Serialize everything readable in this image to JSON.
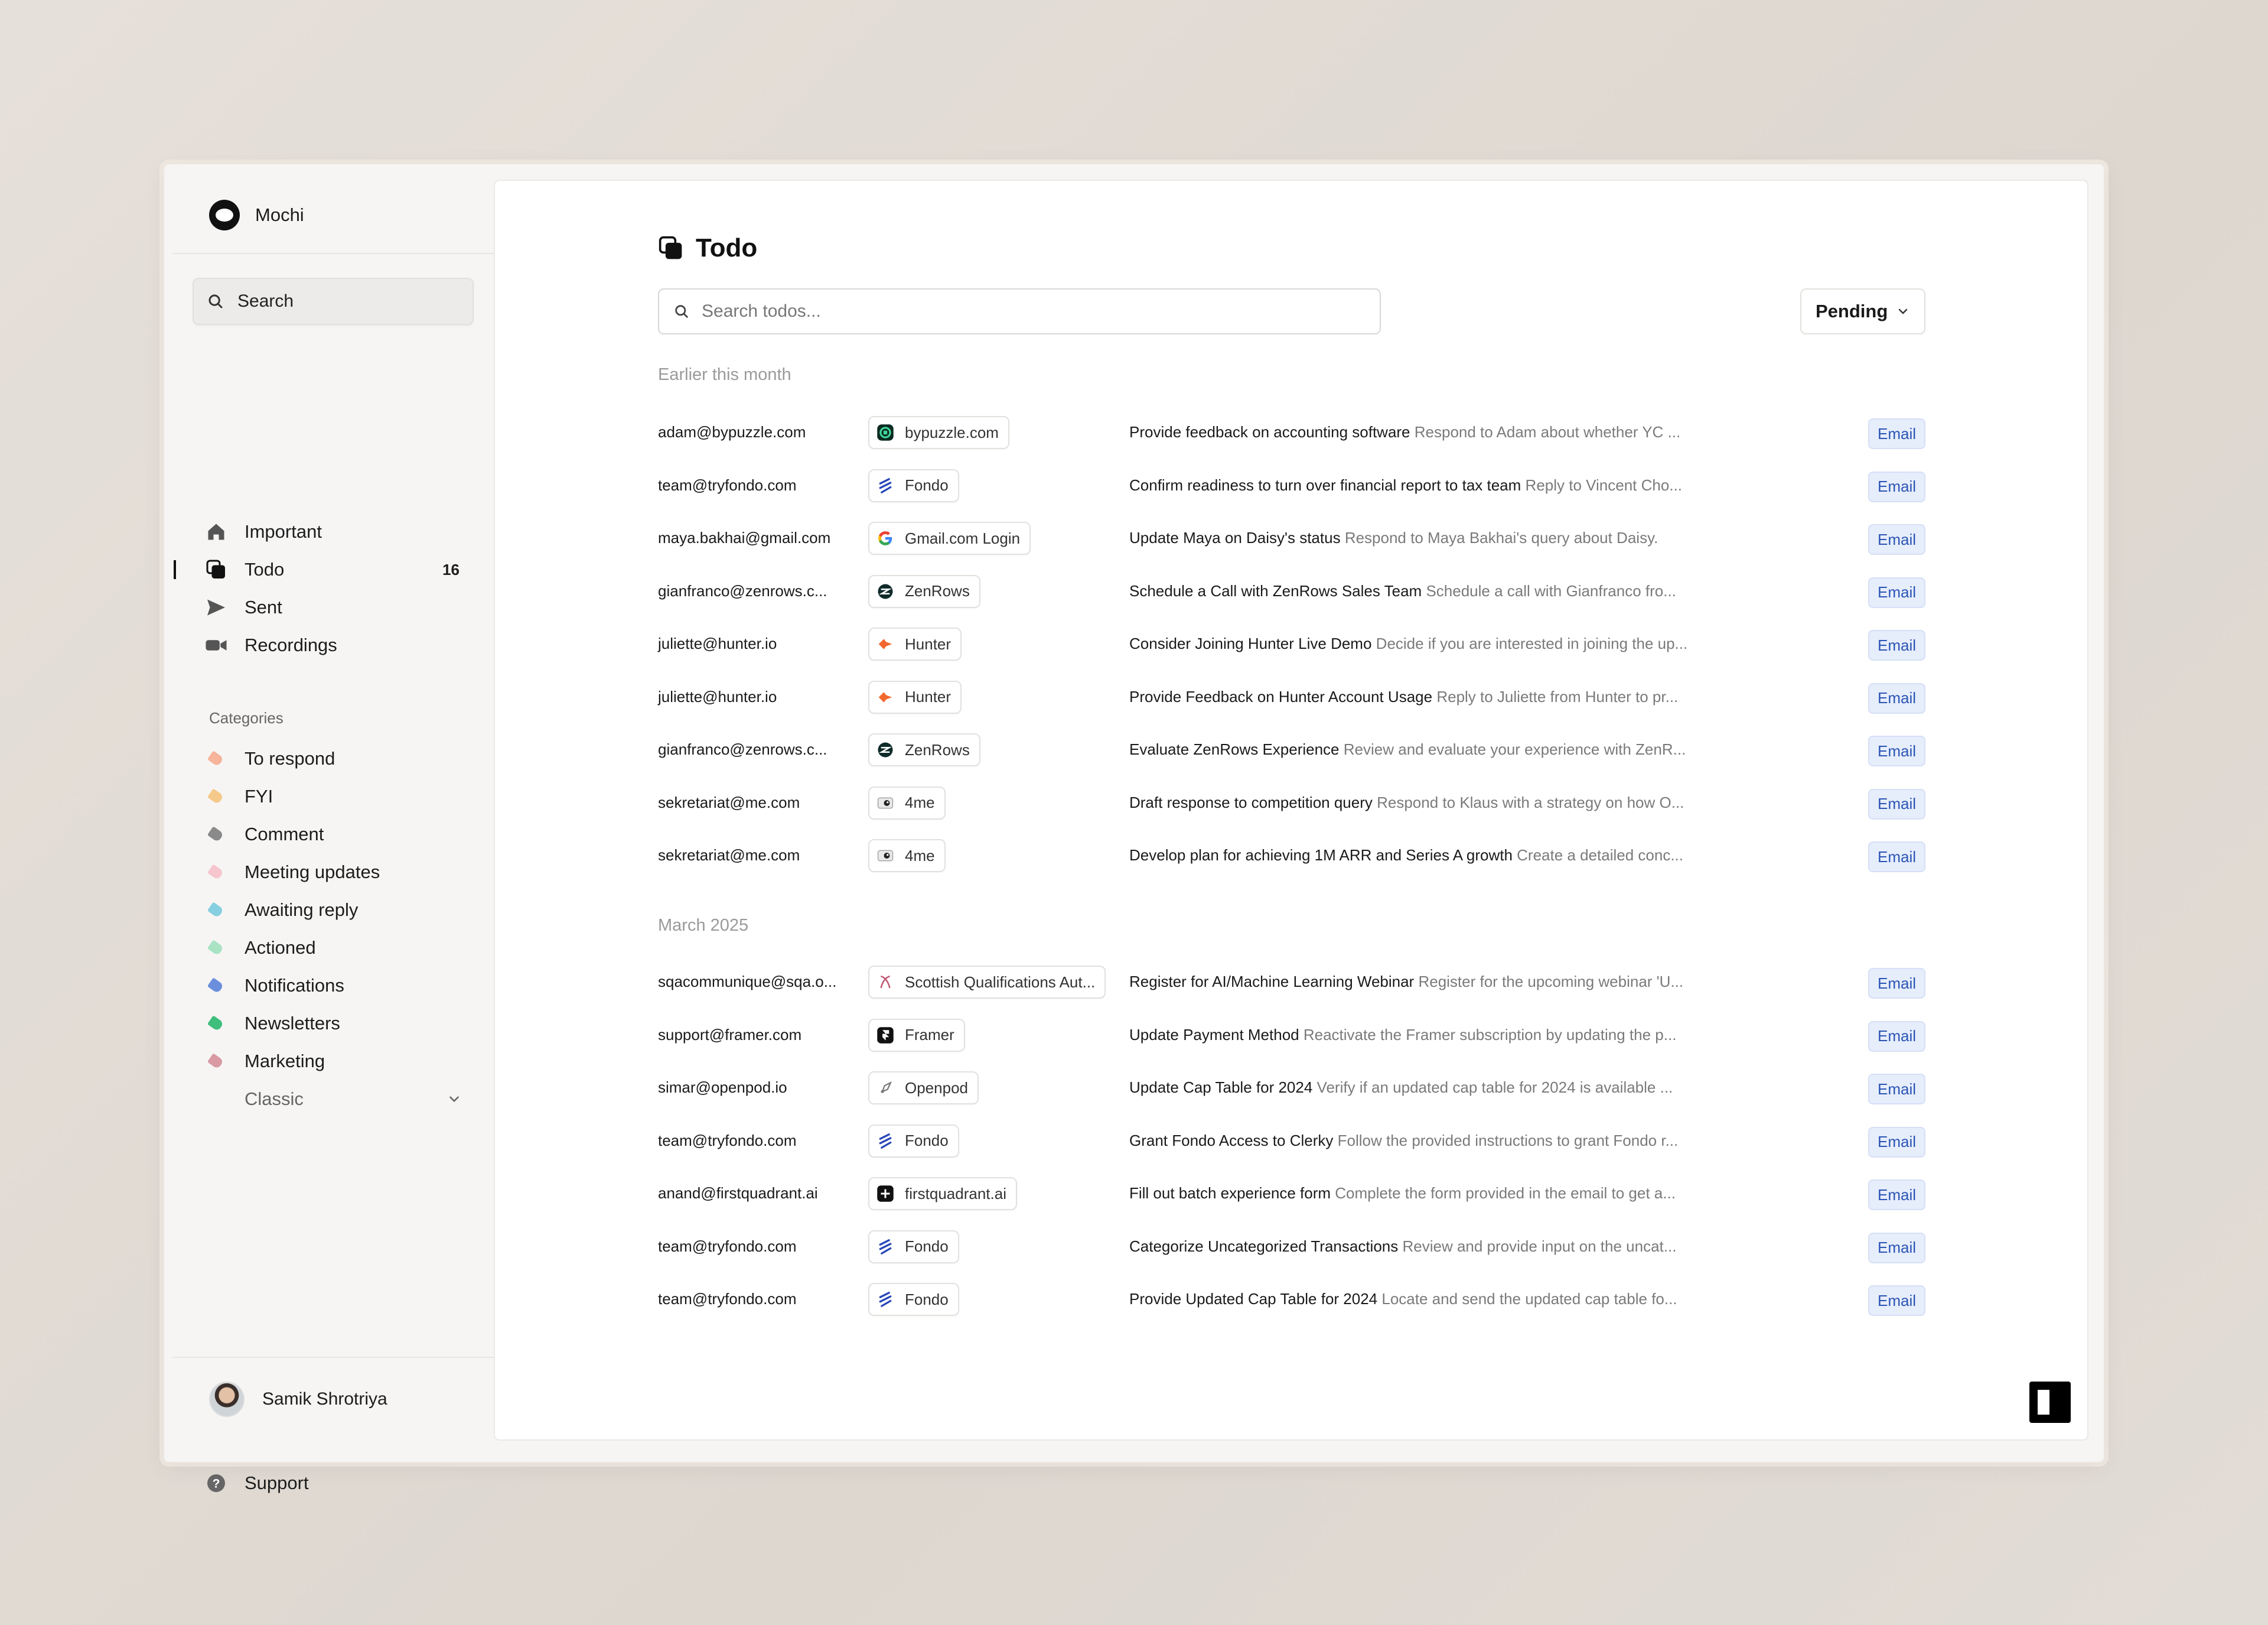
{
  "app": {
    "name": "Mochi"
  },
  "sidebar": {
    "search_label": "Search",
    "nav": [
      {
        "label": "Important",
        "icon": "home-icon"
      },
      {
        "label": "Todo",
        "icon": "todo-icon",
        "count": "16",
        "active": true
      },
      {
        "label": "Sent",
        "icon": "send-icon"
      },
      {
        "label": "Recordings",
        "icon": "video-icon"
      }
    ],
    "categories_title": "Categories",
    "categories": [
      {
        "label": "To respond",
        "color": "#f6b49a"
      },
      {
        "label": "FYI",
        "color": "#f5c98a"
      },
      {
        "label": "Comment",
        "color": "#8a8a8a"
      },
      {
        "label": "Meeting updates",
        "color": "#f6c6cf"
      },
      {
        "label": "Awaiting reply",
        "color": "#86cfe0"
      },
      {
        "label": "Actioned",
        "color": "#a9e3c4"
      },
      {
        "label": "Notifications",
        "color": "#6b8fdc"
      },
      {
        "label": "Newsletters",
        "color": "#3fbe7c"
      },
      {
        "label": "Marketing",
        "color": "#d99aa3"
      }
    ],
    "classic_label": "Classic",
    "support_label": "Support",
    "user_name": "Samik Shrotriya"
  },
  "main": {
    "title": "Todo",
    "search_placeholder": "Search todos...",
    "filter_label": "Pending",
    "groups": [
      {
        "label": "Earlier this month",
        "rows": [
          {
            "sender": "adam@bypuzzle.com",
            "source": "bypuzzle.com",
            "source_icon": "bypuzzle",
            "title": "Provide feedback on accounting software",
            "summary": "Respond to Adam about whether YC ...",
            "badge": "Email"
          },
          {
            "sender": "team@tryfondo.com",
            "source": "Fondo",
            "source_icon": "fondo",
            "title": "Confirm readiness to turn over financial report to tax team",
            "summary": "Reply to Vincent Cho...",
            "badge": "Email"
          },
          {
            "sender": "maya.bakhai@gmail.com",
            "source": "Gmail.com Login",
            "source_icon": "google",
            "title": "Update Maya on Daisy's status",
            "summary": "Respond to Maya Bakhai's query about Daisy.",
            "badge": "Email"
          },
          {
            "sender": "gianfranco@zenrows.c...",
            "source": "ZenRows",
            "source_icon": "zenrows",
            "title": "Schedule a Call with ZenRows Sales Team",
            "summary": "Schedule a call with Gianfranco fro...",
            "badge": "Email"
          },
          {
            "sender": "juliette@hunter.io",
            "source": "Hunter",
            "source_icon": "hunter",
            "title": "Consider Joining Hunter Live Demo",
            "summary": "Decide if you are interested in joining the up...",
            "badge": "Email"
          },
          {
            "sender": "juliette@hunter.io",
            "source": "Hunter",
            "source_icon": "hunter",
            "title": "Provide Feedback on Hunter Account Usage",
            "summary": "Reply to Juliette from Hunter to pr...",
            "badge": "Email"
          },
          {
            "sender": "gianfranco@zenrows.c...",
            "source": "ZenRows",
            "source_icon": "zenrows",
            "title": "Evaluate ZenRows Experience",
            "summary": "Review and evaluate your experience with ZenR...",
            "badge": "Email"
          },
          {
            "sender": "sekretariat@me.com",
            "source": "4me",
            "source_icon": "4me",
            "title": "Draft response to competition query",
            "summary": "Respond to Klaus with a strategy on how O...",
            "badge": "Email"
          },
          {
            "sender": "sekretariat@me.com",
            "source": "4me",
            "source_icon": "4me",
            "title": "Develop plan for achieving 1M ARR and Series A growth",
            "summary": "Create a detailed conc...",
            "badge": "Email"
          }
        ]
      },
      {
        "label": "March 2025",
        "rows": [
          {
            "sender": "sqacommunique@sqa.o...",
            "source": "Scottish Qualifications Aut...",
            "source_icon": "sqa",
            "title": "Register for AI/Machine Learning Webinar",
            "summary": "Register for the upcoming webinar 'U...",
            "badge": "Email"
          },
          {
            "sender": "support@framer.com",
            "source": "Framer",
            "source_icon": "framer",
            "title": "Update Payment Method",
            "summary": "Reactivate the Framer subscription by updating the p...",
            "badge": "Email"
          },
          {
            "sender": "simar@openpod.io",
            "source": "Openpod",
            "source_icon": "openpod",
            "title": "Update Cap Table for 2024",
            "summary": "Verify if an updated cap table for 2024 is available ...",
            "badge": "Email"
          },
          {
            "sender": "team@tryfondo.com",
            "source": "Fondo",
            "source_icon": "fondo",
            "title": "Grant Fondo Access to Clerky",
            "summary": "Follow the provided instructions to grant Fondo r...",
            "badge": "Email"
          },
          {
            "sender": "anand@firstquadrant.ai",
            "source": "firstquadrant.ai",
            "source_icon": "firstquadrant",
            "title": "Fill out batch experience form",
            "summary": "Complete the form provided in the email to get a...",
            "badge": "Email"
          },
          {
            "sender": "team@tryfondo.com",
            "source": "Fondo",
            "source_icon": "fondo",
            "title": "Categorize Uncategorized Transactions",
            "summary": "Review and provide input on the uncat...",
            "badge": "Email"
          },
          {
            "sender": "team@tryfondo.com",
            "source": "Fondo",
            "source_icon": "fondo",
            "title": "Provide Updated Cap Table for 2024",
            "summary": "Locate and send the updated cap table fo...",
            "badge": "Email"
          }
        ]
      }
    ]
  }
}
